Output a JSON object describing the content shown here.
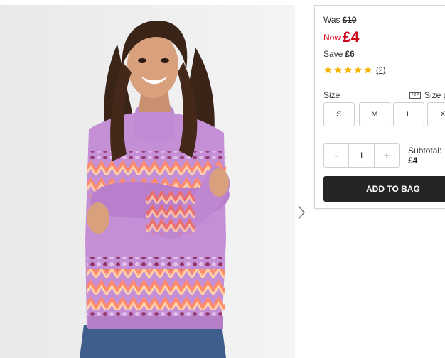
{
  "product": {
    "image_alt": "Woman wearing a lilac fairisle sequin jumper"
  },
  "pricing": {
    "was_label": "Was",
    "was_price": "£10",
    "now_label": "Now",
    "now_price": "£4",
    "save_label": "Save",
    "save_amount": "£6"
  },
  "rating": {
    "stars": 5,
    "count_text": "(2)",
    "star_color": "#f5b400"
  },
  "size": {
    "label": "Size",
    "guide_label": "Size g",
    "options": [
      "S",
      "M",
      "L",
      "X"
    ]
  },
  "quantity": {
    "minus": "-",
    "value": "1",
    "plus": "+"
  },
  "subtotal": {
    "label": "Subtotal:",
    "value": "£4"
  },
  "cta": {
    "add_to_bag": "ADD TO BAG",
    "color": "#252525"
  },
  "colors": {
    "accent_red": "#d0021b"
  }
}
